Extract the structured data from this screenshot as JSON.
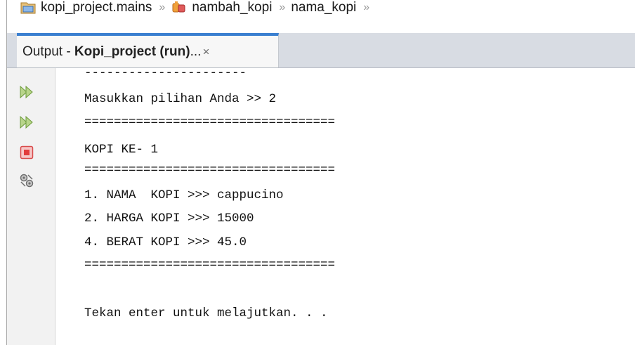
{
  "breadcrumb": {
    "items": [
      {
        "label": "kopi_project.mains",
        "icon": "package-icon"
      },
      {
        "label": "nambah_kopi",
        "icon": "method-icon"
      },
      {
        "label": "nama_kopi",
        "icon": ""
      }
    ],
    "separator": "»"
  },
  "output_tab": {
    "prefix": "Output - ",
    "project": "Kopi_project (run)",
    "suffix": " ...",
    "close": "×"
  },
  "toolbar": {
    "buttons": [
      {
        "name": "rerun-icon"
      },
      {
        "name": "rerun-with-options-icon"
      },
      {
        "name": "stop-icon"
      },
      {
        "name": "settings-icon"
      }
    ]
  },
  "console": {
    "lines": [
      "----------------------",
      "Masukkan pilihan Anda >> 2",
      "==================================",
      "KOPI KE- 1",
      "==================================",
      "1. NAMA  KOPI >>> cappucino",
      "2. HARGA KOPI >>> 15000",
      "4. BERAT KOPI >>> 45.0",
      "==================================",
      "",
      "Tekan enter untuk melajutkan. . ."
    ]
  }
}
